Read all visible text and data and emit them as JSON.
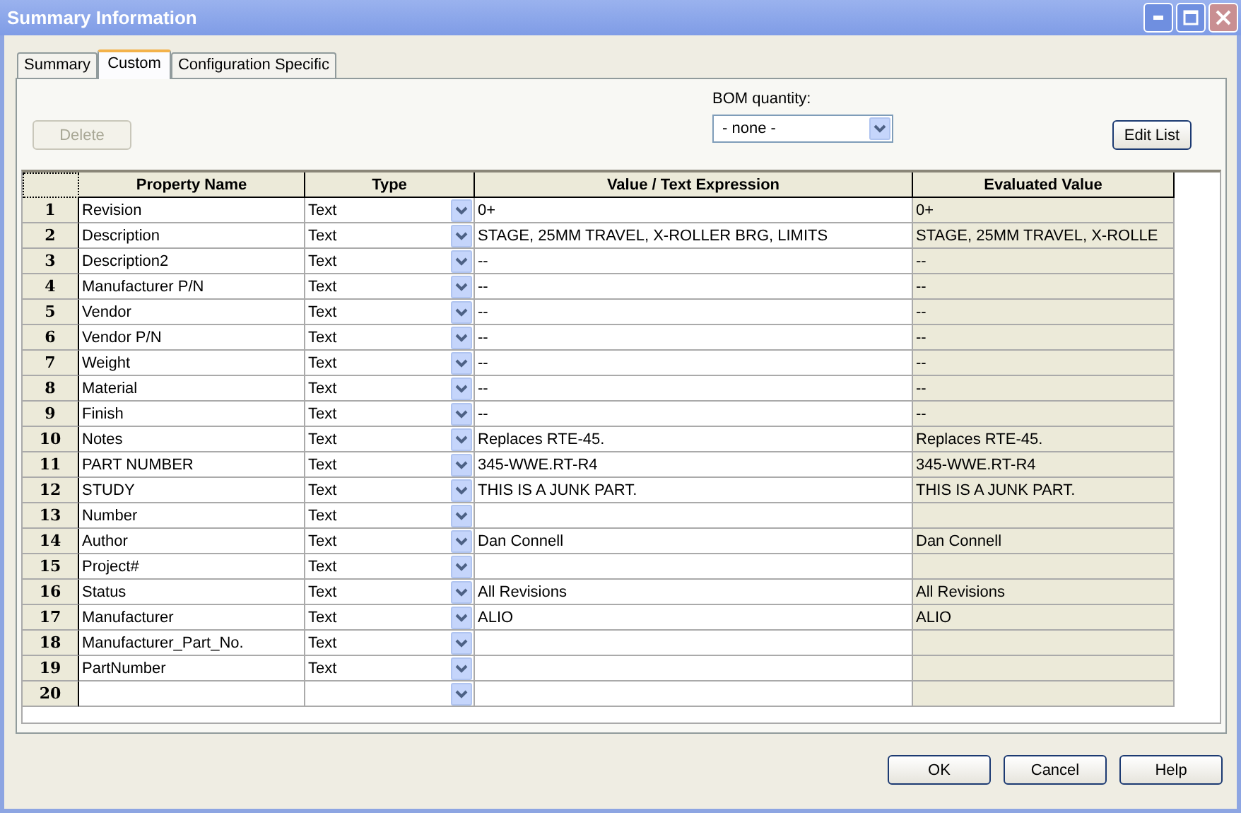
{
  "window": {
    "title": "Summary Information"
  },
  "tabs": [
    {
      "label": "Summary",
      "selected": false
    },
    {
      "label": "Custom",
      "selected": true
    },
    {
      "label": "Configuration Specific",
      "selected": false
    }
  ],
  "delete_button": {
    "label": "Delete",
    "disabled": true
  },
  "bom_quantity": {
    "label": "BOM quantity:",
    "value": "- none -"
  },
  "edit_list_button": {
    "label": "Edit List"
  },
  "table": {
    "columns": [
      "Property Name",
      "Type",
      "Value / Text Expression",
      "Evaluated Value"
    ],
    "rows": [
      {
        "number": "1",
        "name": "Revision",
        "type": "Text",
        "value": "0+",
        "evaluated": "0+"
      },
      {
        "number": "2",
        "name": "Description",
        "type": "Text",
        "value": "STAGE, 25MM TRAVEL, X-ROLLER BRG, LIMITS",
        "evaluated": "STAGE, 25MM TRAVEL, X-ROLLE"
      },
      {
        "number": "3",
        "name": "Description2",
        "type": "Text",
        "value": "--",
        "evaluated": "--"
      },
      {
        "number": "4",
        "name": "Manufacturer P/N",
        "type": "Text",
        "value": "--",
        "evaluated": "--"
      },
      {
        "number": "5",
        "name": "Vendor",
        "type": "Text",
        "value": "--",
        "evaluated": "--"
      },
      {
        "number": "6",
        "name": "Vendor P/N",
        "type": "Text",
        "value": "--",
        "evaluated": "--"
      },
      {
        "number": "7",
        "name": "Weight",
        "type": "Text",
        "value": "--",
        "evaluated": "--"
      },
      {
        "number": "8",
        "name": "Material",
        "type": "Text",
        "value": "--",
        "evaluated": "--"
      },
      {
        "number": "9",
        "name": "Finish",
        "type": "Text",
        "value": "--",
        "evaluated": "--"
      },
      {
        "number": "10",
        "name": "Notes",
        "type": "Text",
        "value": "Replaces RTE-45.",
        "evaluated": "Replaces RTE-45."
      },
      {
        "number": "11",
        "name": "PART NUMBER",
        "type": "Text",
        "value": "345-WWE.RT-R4",
        "evaluated": "345-WWE.RT-R4"
      },
      {
        "number": "12",
        "name": "STUDY",
        "type": "Text",
        "value": "THIS IS A JUNK PART.",
        "evaluated": "THIS IS A JUNK PART."
      },
      {
        "number": "13",
        "name": "Number",
        "type": "Text"
      },
      {
        "number": "14",
        "name": "Author",
        "type": "Text",
        "value": "Dan Connell",
        "evaluated": "Dan Connell"
      },
      {
        "number": "15",
        "name": "Project#",
        "type": "Text"
      },
      {
        "number": "16",
        "name": "Status",
        "type": "Text",
        "value": "All Revisions",
        "evaluated": "All Revisions"
      },
      {
        "number": "17",
        "name": "Manufacturer",
        "type": "Text",
        "value": "ALIO",
        "evaluated": "ALIO"
      },
      {
        "number": "18",
        "name": "Manufacturer_Part_No.",
        "type": "Text"
      },
      {
        "number": "19",
        "name": "PartNumber",
        "type": "Text"
      },
      {
        "number": "20"
      }
    ]
  },
  "buttons": [
    "OK",
    "Cancel",
    "Help"
  ]
}
